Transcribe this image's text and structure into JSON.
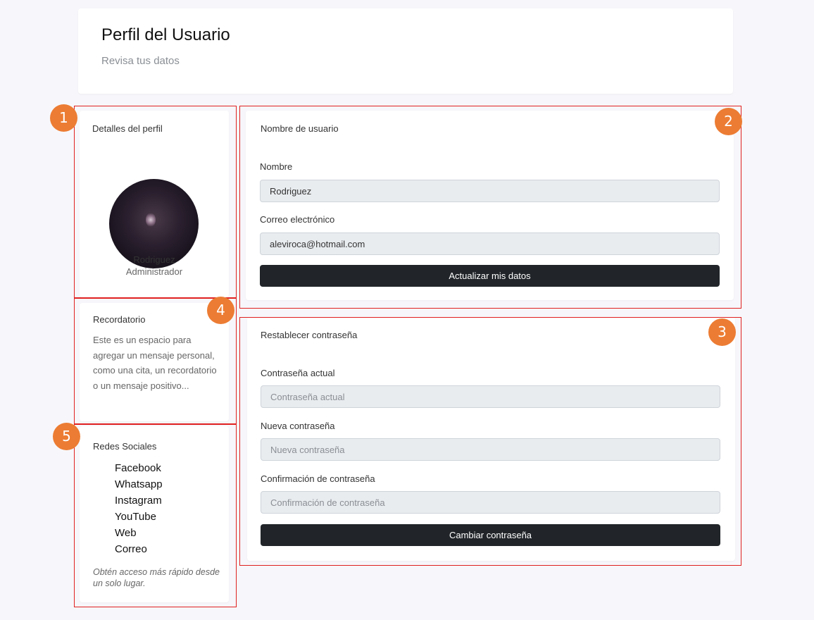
{
  "header": {
    "title": "Perfil del Usuario",
    "subtitle": "Revisa tus datos"
  },
  "profile": {
    "heading": "Detalles del perfil",
    "name": "Rodriguez",
    "role": "Administrador"
  },
  "reminder": {
    "heading": "Recordatorio",
    "text": "Este es un espacio para agregar un mensaje personal, como una cita, un recordatorio o un mensaje positivo..."
  },
  "social": {
    "heading": "Redes Sociales",
    "links": [
      "Facebook",
      "Whatsapp",
      "Instagram",
      "YouTube",
      "Web",
      "Correo"
    ],
    "footer": "Obtén acceso más rápido desde un solo lugar."
  },
  "user_form": {
    "heading": "Nombre de usuario",
    "name_label": "Nombre",
    "name_value": "Rodriguez",
    "email_label": "Correo electrónico",
    "email_value": "aleviroca@hotmail.com",
    "submit_label": "Actualizar mis datos"
  },
  "password_form": {
    "heading": "Restablecer contraseña",
    "current_label": "Contraseña actual",
    "current_placeholder": "Contraseña actual",
    "new_label": "Nueva contraseña",
    "new_placeholder": "Nueva contraseña",
    "confirm_label": "Confirmación de contraseña",
    "confirm_placeholder": "Confirmación de contraseña",
    "submit_label": "Cambiar contraseña"
  },
  "annotations": {
    "badges": [
      "1",
      "2",
      "3",
      "4",
      "5"
    ],
    "border_color": "#e02020",
    "badge_color": "#ec7c33"
  }
}
